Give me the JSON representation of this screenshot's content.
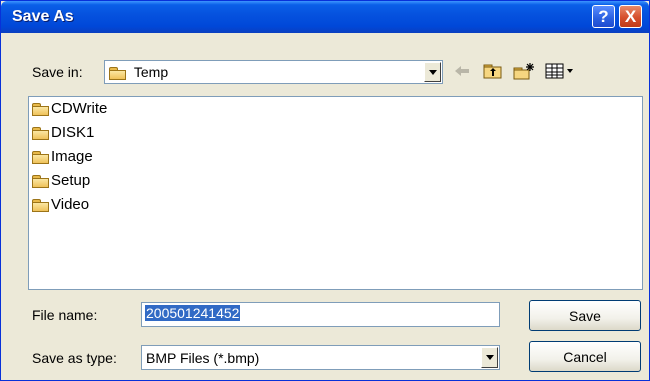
{
  "window": {
    "title": "Save As"
  },
  "titlebar": {
    "help": "?",
    "close": "X"
  },
  "save_in": {
    "label": "Save in:",
    "value": "Temp"
  },
  "files": [
    {
      "name": "CDWrite"
    },
    {
      "name": "DISK1"
    },
    {
      "name": "Image"
    },
    {
      "name": "Setup"
    },
    {
      "name": "Video"
    }
  ],
  "file_name": {
    "label": "File name:",
    "value": "200501241452"
  },
  "save_as_type": {
    "label": "Save as type:",
    "value": "BMP Files (*.bmp)"
  },
  "buttons": {
    "save": "Save",
    "cancel": "Cancel"
  },
  "colors": {
    "titlebar": "#0653df",
    "window": "#ece9d8",
    "selection": "#316ac5"
  },
  "toolbar_icons": [
    "back-arrow-icon",
    "up-folder-icon",
    "new-folder-icon",
    "view-menu-icon"
  ]
}
